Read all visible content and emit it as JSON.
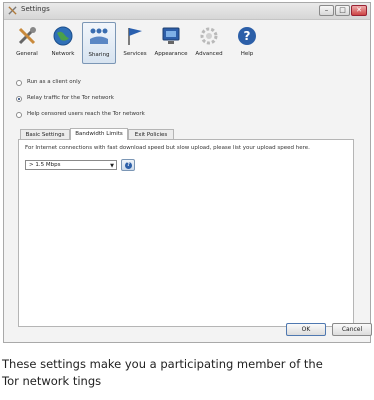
{
  "window": {
    "title": "Settings",
    "controls": {
      "minimize": "–",
      "maximize": "□",
      "close": "✕"
    }
  },
  "toolbar": {
    "items": [
      {
        "label": "General",
        "icon": "tools-icon"
      },
      {
        "label": "Network",
        "icon": "globe-icon"
      },
      {
        "label": "Sharing",
        "icon": "sharing-icon"
      },
      {
        "label": "Services",
        "icon": "flag-icon"
      },
      {
        "label": "Appearance",
        "icon": "monitor-icon"
      },
      {
        "label": "Advanced",
        "icon": "gear-icon"
      },
      {
        "label": "Help",
        "icon": "help-icon"
      }
    ],
    "active": "Sharing"
  },
  "sharing": {
    "options": [
      {
        "label": "Run as a client only",
        "checked": false
      },
      {
        "label": "Relay traffic for the Tor network",
        "checked": true
      },
      {
        "label": "Help censored users reach the Tor network",
        "checked": false
      }
    ]
  },
  "tabs": [
    {
      "label": "Basic Settings",
      "active": false
    },
    {
      "label": "Bandwidth Limits",
      "active": true
    },
    {
      "label": "Exit Policies",
      "active": false
    }
  ],
  "bandwidth": {
    "description": "For Internet connections with fast download speed but slow upload, please list your upload speed here.",
    "selected": "> 1.5 Mbps",
    "help_glyph": "?"
  },
  "buttons": {
    "ok": "OK",
    "cancel": "Cancel"
  },
  "caption": {
    "line1": "These settings make you a participating member of the",
    "line2": "Tor network tings"
  }
}
